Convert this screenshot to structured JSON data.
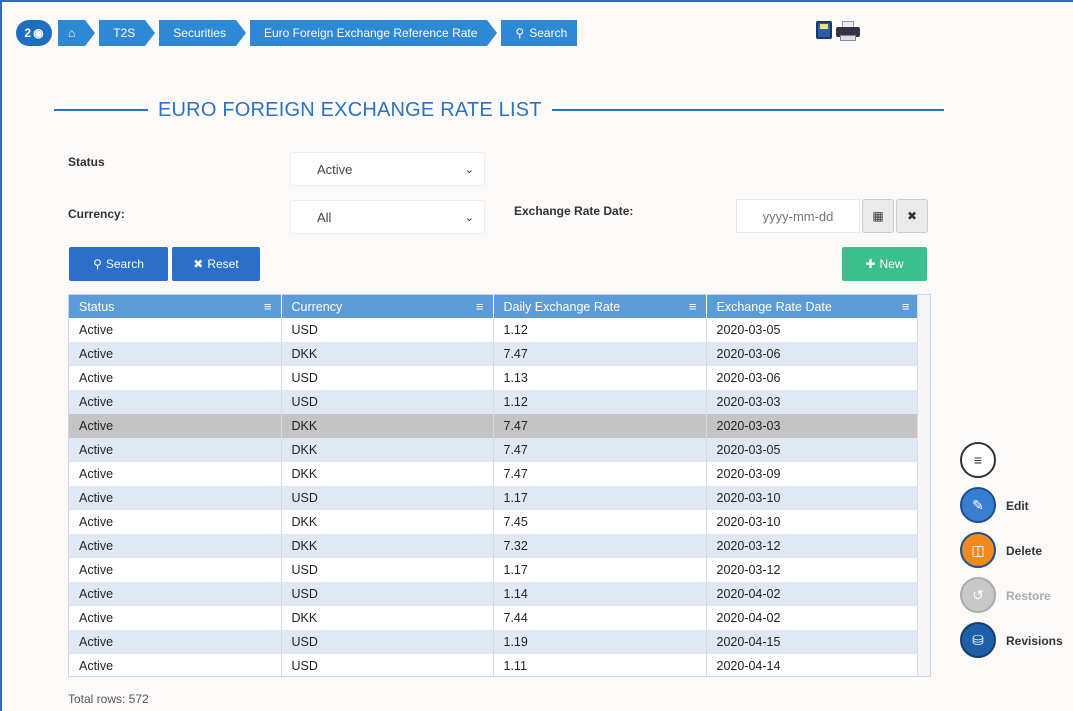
{
  "breadcrumb": {
    "badge": "2",
    "badge_icon": "eye-icon",
    "items": [
      "T2S",
      "Securities",
      "Euro Foreign Exchange Reference Rate",
      "Search"
    ]
  },
  "title": "EURO FOREIGN EXCHANGE RATE LIST",
  "filters": {
    "status_label": "Status",
    "status_value": "Active",
    "currency_label": "Currency:",
    "currency_value": "All",
    "date_label": "Exchange Rate Date:",
    "date_placeholder": "yyyy-mm-dd"
  },
  "buttons": {
    "search": "Search",
    "reset": "Reset",
    "new": "New"
  },
  "table": {
    "columns": [
      "Status",
      "Currency",
      "Daily Exchange Rate",
      "Exchange Rate Date"
    ],
    "rows": [
      [
        "Active",
        "USD",
        "1.12",
        "2020-03-05"
      ],
      [
        "Active",
        "DKK",
        "7.47",
        "2020-03-06"
      ],
      [
        "Active",
        "USD",
        "1.13",
        "2020-03-06"
      ],
      [
        "Active",
        "USD",
        "1.12",
        "2020-03-03"
      ],
      [
        "Active",
        "DKK",
        "7.47",
        "2020-03-03"
      ],
      [
        "Active",
        "DKK",
        "7.47",
        "2020-03-05"
      ],
      [
        "Active",
        "DKK",
        "7.47",
        "2020-03-09"
      ],
      [
        "Active",
        "USD",
        "1.17",
        "2020-03-10"
      ],
      [
        "Active",
        "DKK",
        "7.45",
        "2020-03-10"
      ],
      [
        "Active",
        "DKK",
        "7.32",
        "2020-03-12"
      ],
      [
        "Active",
        "USD",
        "1.17",
        "2020-03-12"
      ],
      [
        "Active",
        "USD",
        "1.14",
        "2020-04-02"
      ],
      [
        "Active",
        "DKK",
        "7.44",
        "2020-04-02"
      ],
      [
        "Active",
        "USD",
        "1.19",
        "2020-04-15"
      ],
      [
        "Active",
        "USD",
        "1.11",
        "2020-04-14"
      ]
    ],
    "selected_row": 4
  },
  "total_rows": "Total rows: 572",
  "side_actions": {
    "edit": "Edit",
    "delete": "Delete",
    "restore": "Restore",
    "revisions": "Revisions"
  },
  "colors": {
    "primary": "#2a6fc9",
    "breadcrumb": "#2e88d6",
    "new_button": "#3cbf8c",
    "delete": "#f08a1c",
    "header": "#5b9bd8"
  }
}
